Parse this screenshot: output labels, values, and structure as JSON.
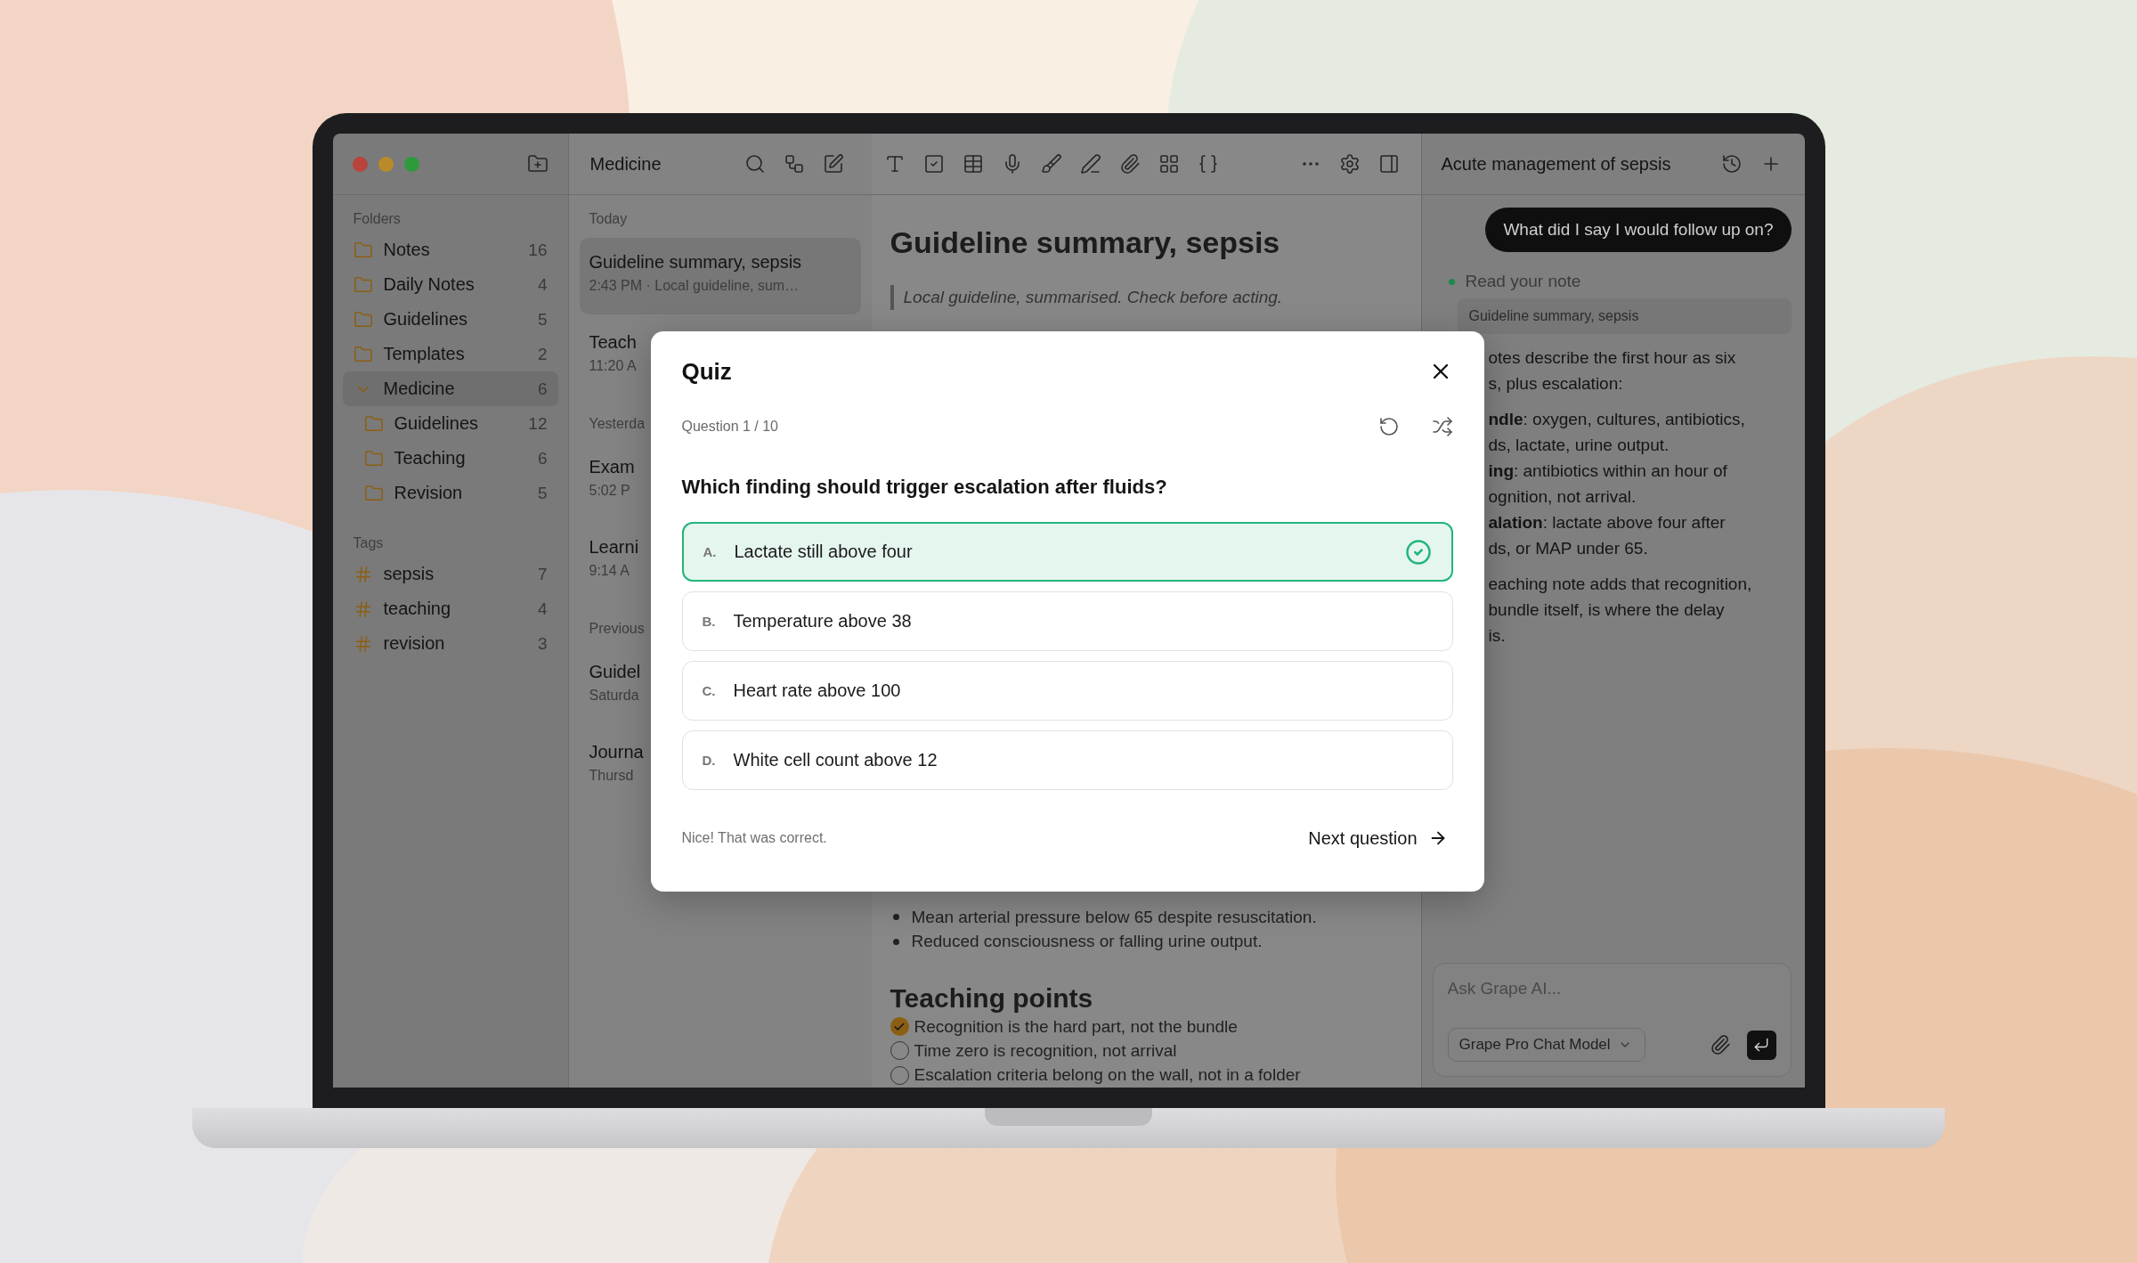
{
  "sidebar": {
    "folders_label": "Folders",
    "folders": [
      {
        "name": "Notes",
        "count": "16",
        "selected": false
      },
      {
        "name": "Daily Notes",
        "count": "4",
        "selected": false
      },
      {
        "name": "Guidelines",
        "count": "5",
        "selected": false
      },
      {
        "name": "Templates",
        "count": "2",
        "selected": false
      },
      {
        "name": "Medicine",
        "count": "6",
        "selected": true,
        "expanded": true,
        "children": [
          {
            "name": "Guidelines",
            "count": "12",
            "selected": false
          },
          {
            "name": "Teaching",
            "count": "6",
            "selected": false
          },
          {
            "name": "Revision",
            "count": "5",
            "selected": false
          }
        ]
      }
    ],
    "tags_label": "Tags",
    "tags": [
      {
        "name": "sepsis",
        "count": "7"
      },
      {
        "name": "teaching",
        "count": "4"
      },
      {
        "name": "revision",
        "count": "3"
      }
    ]
  },
  "note_list": {
    "title": "Medicine",
    "groups": [
      {
        "label": "Today",
        "notes": [
          {
            "title": "Guideline summary, sepsis",
            "meta": "2:43 PM · Local guideline, sum…",
            "selected": true
          },
          {
            "title": "Teach",
            "meta": "11:20 A",
            "selected": false
          }
        ]
      },
      {
        "label": "Yesterda",
        "notes": [
          {
            "title": "Exam",
            "meta": "5:02 P",
            "selected": false
          },
          {
            "title": "Learni",
            "meta": "9:14 A",
            "selected": false
          }
        ]
      },
      {
        "label": "Previous",
        "notes": [
          {
            "title": "Guidel",
            "meta": "Saturda",
            "selected": false
          },
          {
            "title": "Journa",
            "meta": "Thursd",
            "selected": false
          }
        ]
      }
    ]
  },
  "editor": {
    "title": "Guideline summary, sepsis",
    "quote": "Local guideline, summarised. Check before acting.",
    "bullets": [
      "Mean arterial pressure below 65 despite resuscitation.",
      "Reduced consciousness or falling urine output."
    ],
    "heading": "Teaching points",
    "checklist": [
      {
        "text": "Recognition is the hard part, not the bundle",
        "checked": true
      },
      {
        "text": "Time zero is recognition, not arrival",
        "checked": false
      },
      {
        "text": "Escalation criteria belong on the wall, not in a folder",
        "checked": false
      }
    ]
  },
  "assistant": {
    "title": "Acute management of sepsis",
    "user_message": "What did I say I would follow up on?",
    "step": {
      "label": "Read your note",
      "source": "Guideline summary, sepsis"
    },
    "reply_blocks": [
      [
        "otes describe the first hour as six",
        "s, plus escalation:"
      ],
      [
        "**ndle**: oxygen, cultures, antibiotics,",
        "ds, lactate, urine output.",
        "**ing**: antibiotics within an hour of",
        "ognition, not arrival.",
        "**alation**: lactate above four after",
        "ds, or MAP under 65."
      ],
      [
        "eaching note adds that recognition,",
        "bundle itself, is where the delay",
        "is."
      ]
    ],
    "composer": {
      "placeholder": "Ask Grape AI...",
      "model": "Grape Pro Chat Model"
    }
  },
  "quiz": {
    "title": "Quiz",
    "progress": "Question 1 / 10",
    "question": "Which finding should trigger escalation after fluids?",
    "options": [
      {
        "letter": "A.",
        "text": "Lactate still above four",
        "selected": true
      },
      {
        "letter": "B.",
        "text": "Temperature above 38",
        "selected": false
      },
      {
        "letter": "C.",
        "text": "Heart rate above 100",
        "selected": false
      },
      {
        "letter": "D.",
        "text": "White cell count above 12",
        "selected": false
      }
    ],
    "feedback": "Nice! That was correct.",
    "next": "Next question"
  }
}
